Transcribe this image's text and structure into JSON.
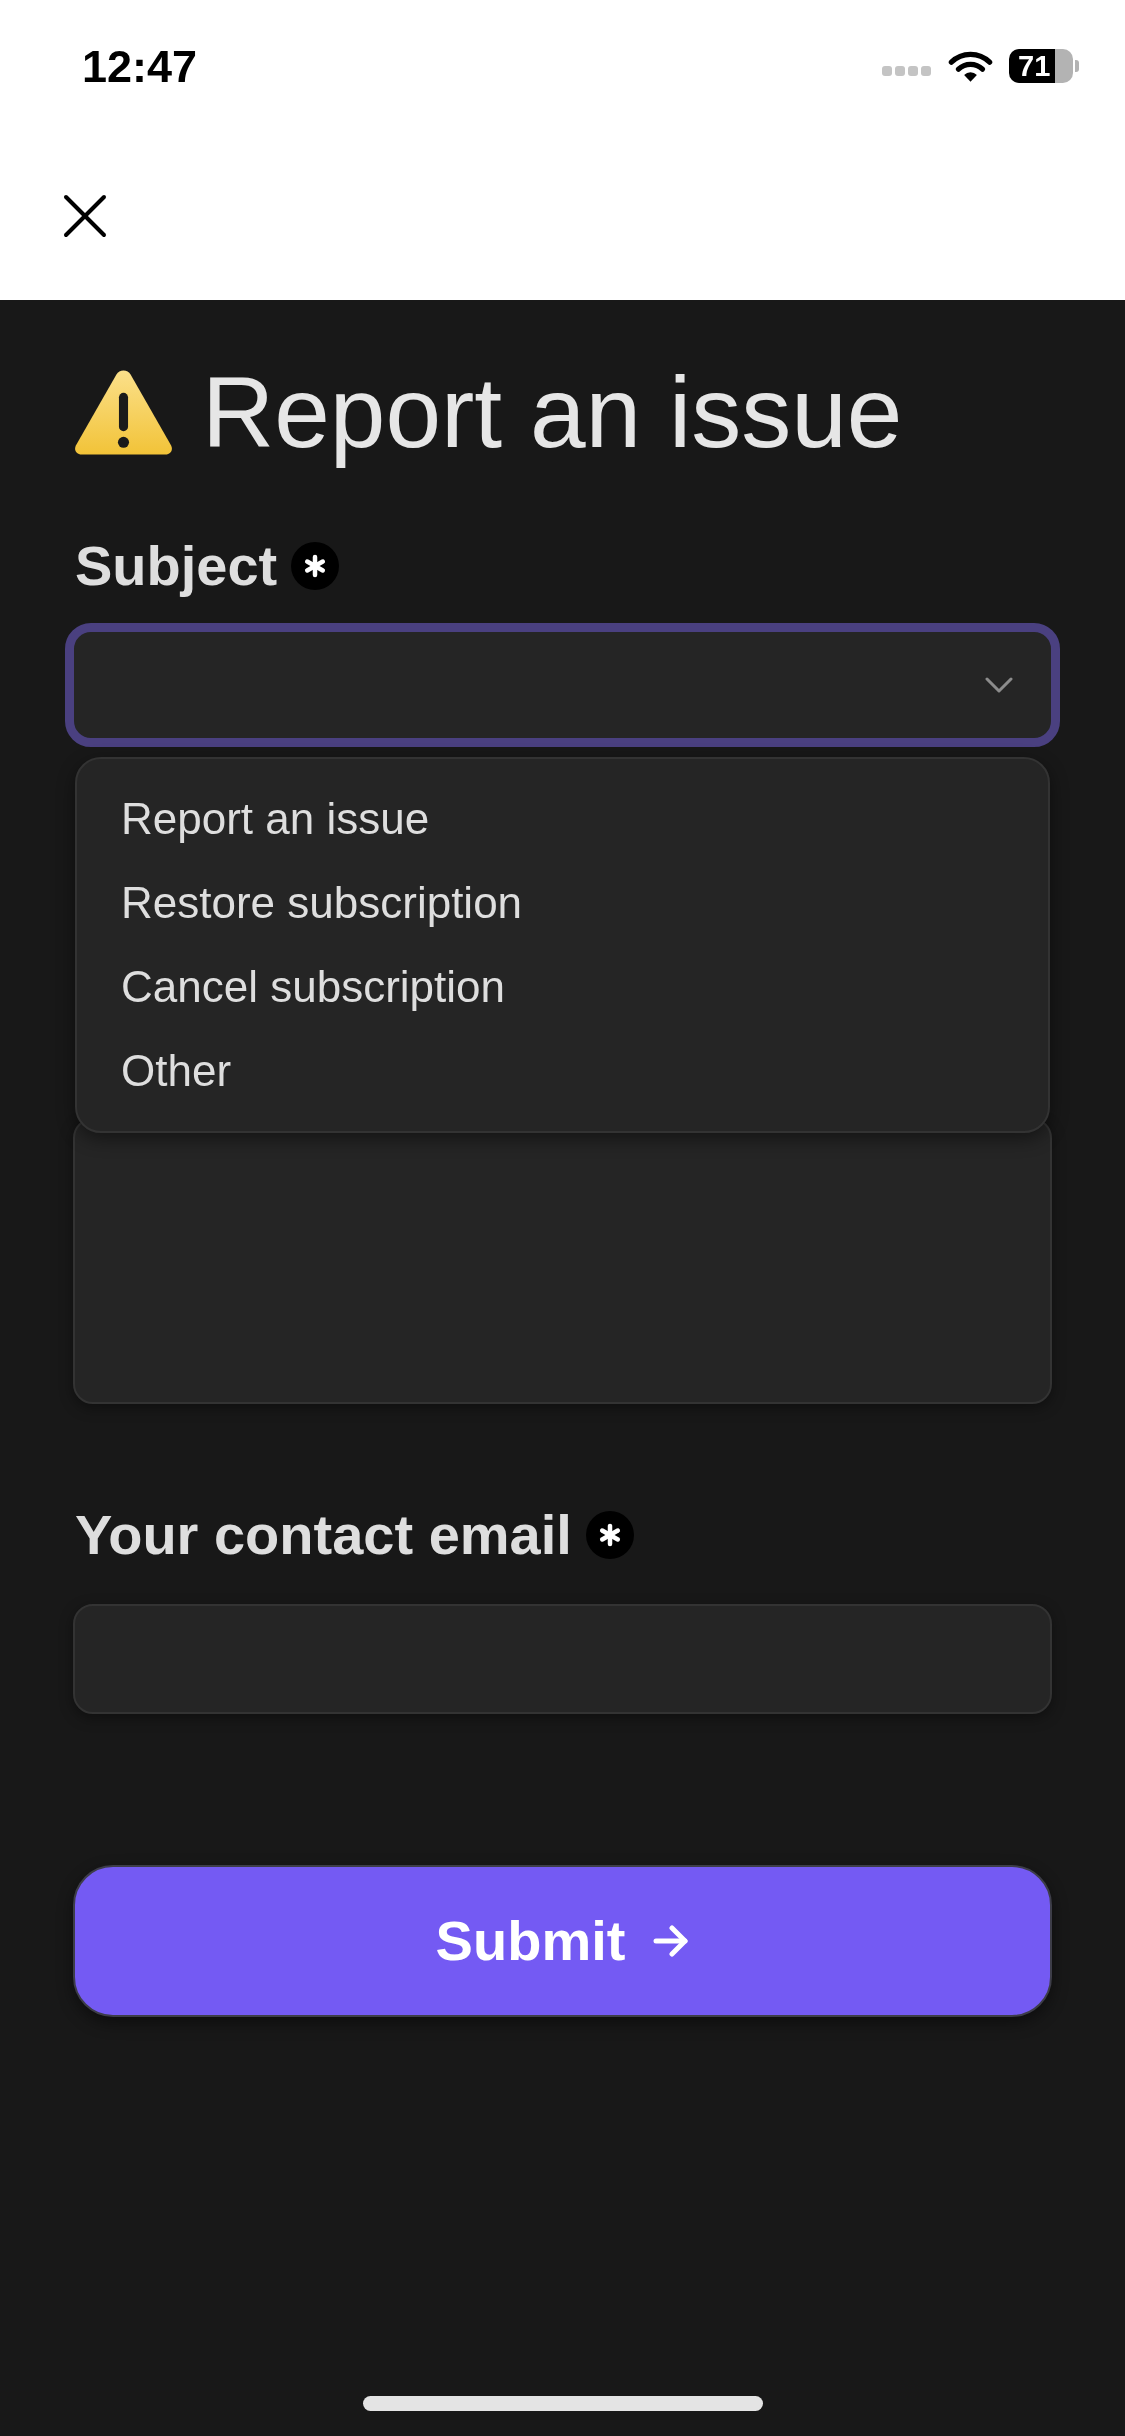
{
  "status_bar": {
    "time": "12:47",
    "battery": "71"
  },
  "title": "Report an issue",
  "fields": [
    {
      "kind": "select",
      "label": "Subject",
      "required": true,
      "expanded": true,
      "options": [
        {
          "label": "Report an issue",
          "selected": false
        },
        {
          "label": "Restore subscription",
          "selected": false
        },
        {
          "label": "Cancel subscription",
          "selected": false
        },
        {
          "label": "Other",
          "selected": false
        }
      ]
    },
    {
      "kind": "textarea"
    },
    {
      "kind": "input",
      "label": "Your contact email",
      "required": true
    }
  ],
  "submit": {
    "label": "Submit"
  }
}
